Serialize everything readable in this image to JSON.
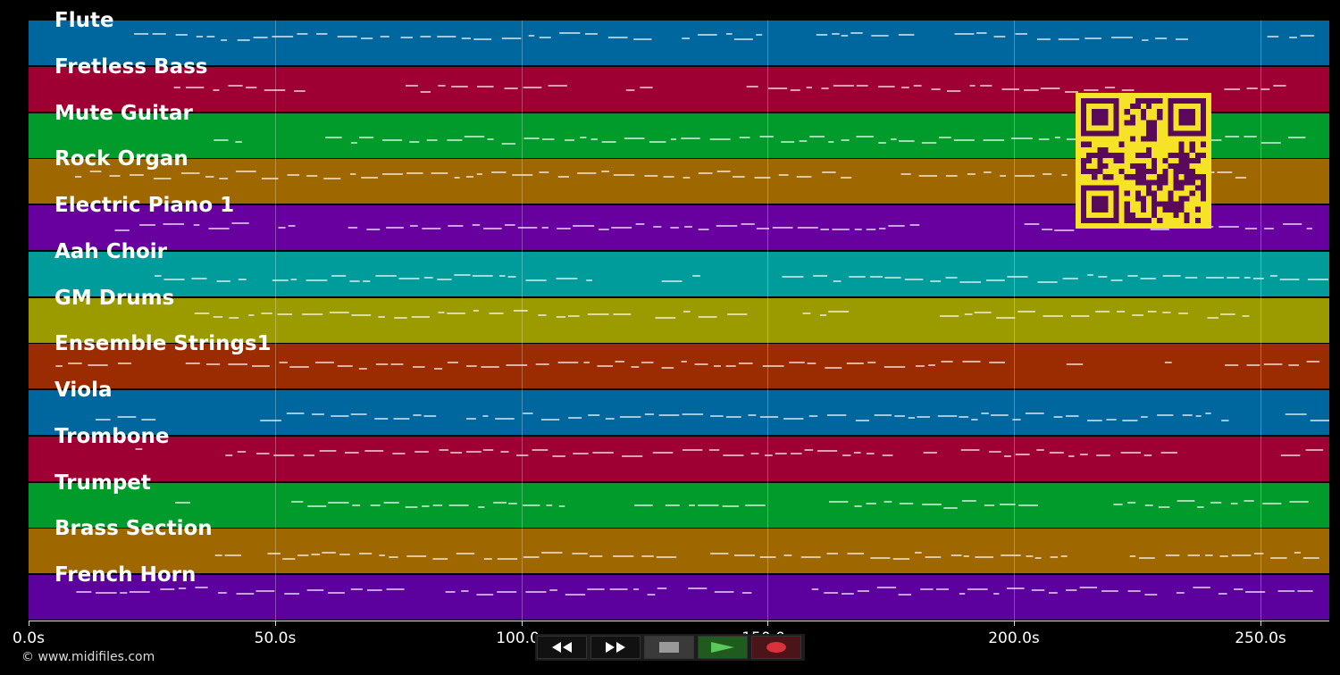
{
  "timeline": {
    "duration_s": 264,
    "ticks": [
      {
        "value": 0,
        "label": "0.0s"
      },
      {
        "value": 50,
        "label": "50.0s"
      },
      {
        "value": 100,
        "label": "100.0s"
      },
      {
        "value": 150,
        "label": "150.0s"
      },
      {
        "value": 200,
        "label": "200.0s"
      },
      {
        "value": 250,
        "label": "250.0s"
      }
    ]
  },
  "tracks": [
    {
      "name": "Flute",
      "color": "#00679e"
    },
    {
      "name": "Fretless Bass",
      "color": "#9e0033"
    },
    {
      "name": "Mute Guitar",
      "color": "#009b2b"
    },
    {
      "name": "Rock Organ",
      "color": "#9e6700"
    },
    {
      "name": "Electric Piano 1",
      "color": "#67009e"
    },
    {
      "name": "Aah Choir",
      "color": "#009b9b"
    },
    {
      "name": "GM Drums",
      "color": "#9b9b00"
    },
    {
      "name": "Ensemble Strings1",
      "color": "#9b2b00"
    },
    {
      "name": "Viola",
      "color": "#00679e"
    },
    {
      "name": "Trombone",
      "color": "#9e0033"
    },
    {
      "name": "Trumpet",
      "color": "#009b2b"
    },
    {
      "name": "Brass Section",
      "color": "#9e6700"
    },
    {
      "name": "French Horn",
      "color": "#5c009e"
    }
  ],
  "transport": {
    "rewind": "rewind-icon",
    "fast_forward": "fast-forward-icon",
    "stop": "stop-icon",
    "play": "play-icon",
    "record": "record-icon",
    "play_color": "#5ac85a",
    "record_color": "#d8323c"
  },
  "qr_code": {
    "color": "#f6e227",
    "bg": "#5a0a5a"
  },
  "footer": {
    "copyright": "© www.midifiles.com"
  }
}
